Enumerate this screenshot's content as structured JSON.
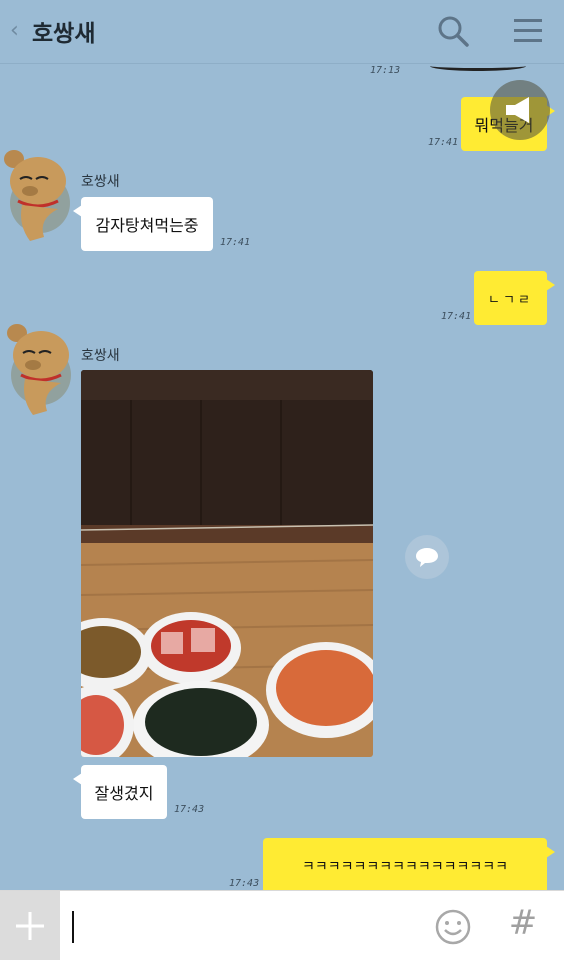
{
  "header": {
    "back_icon": "chevron-left-icon",
    "title": "호쌍새",
    "search_icon": "search-icon",
    "menu_icon": "menu-icon"
  },
  "messages": {
    "prev_time": "17:13",
    "m1": {
      "text": "뭐먹늘거",
      "time": "17:41",
      "from": "me"
    },
    "m2": {
      "sender": "호쌍새",
      "text": "감자탕쳐먹는중",
      "time": "17:41",
      "from": "other"
    },
    "m3": {
      "text": "ㄴㄱㄹ",
      "time": "17:41",
      "from": "me"
    },
    "m4": {
      "sender": "호쌍새",
      "type": "photo",
      "from": "other"
    },
    "m5": {
      "text": "잘생겼지",
      "time": "17:43",
      "from": "other"
    },
    "m6": {
      "text": "ㅋㅋㅋㅋㅋㅋㅋㅋㅋㅋㅋㅋㅋㅋㅋㅋ",
      "time": "17:43",
      "from": "me"
    }
  },
  "input": {
    "value": "",
    "plus_icon": "plus-icon",
    "emoji_icon": "emoji-icon",
    "hash_label": "#"
  },
  "colors": {
    "background": "#9bbbd4",
    "my_bubble": "#ffeb33",
    "their_bubble": "#ffffff"
  }
}
